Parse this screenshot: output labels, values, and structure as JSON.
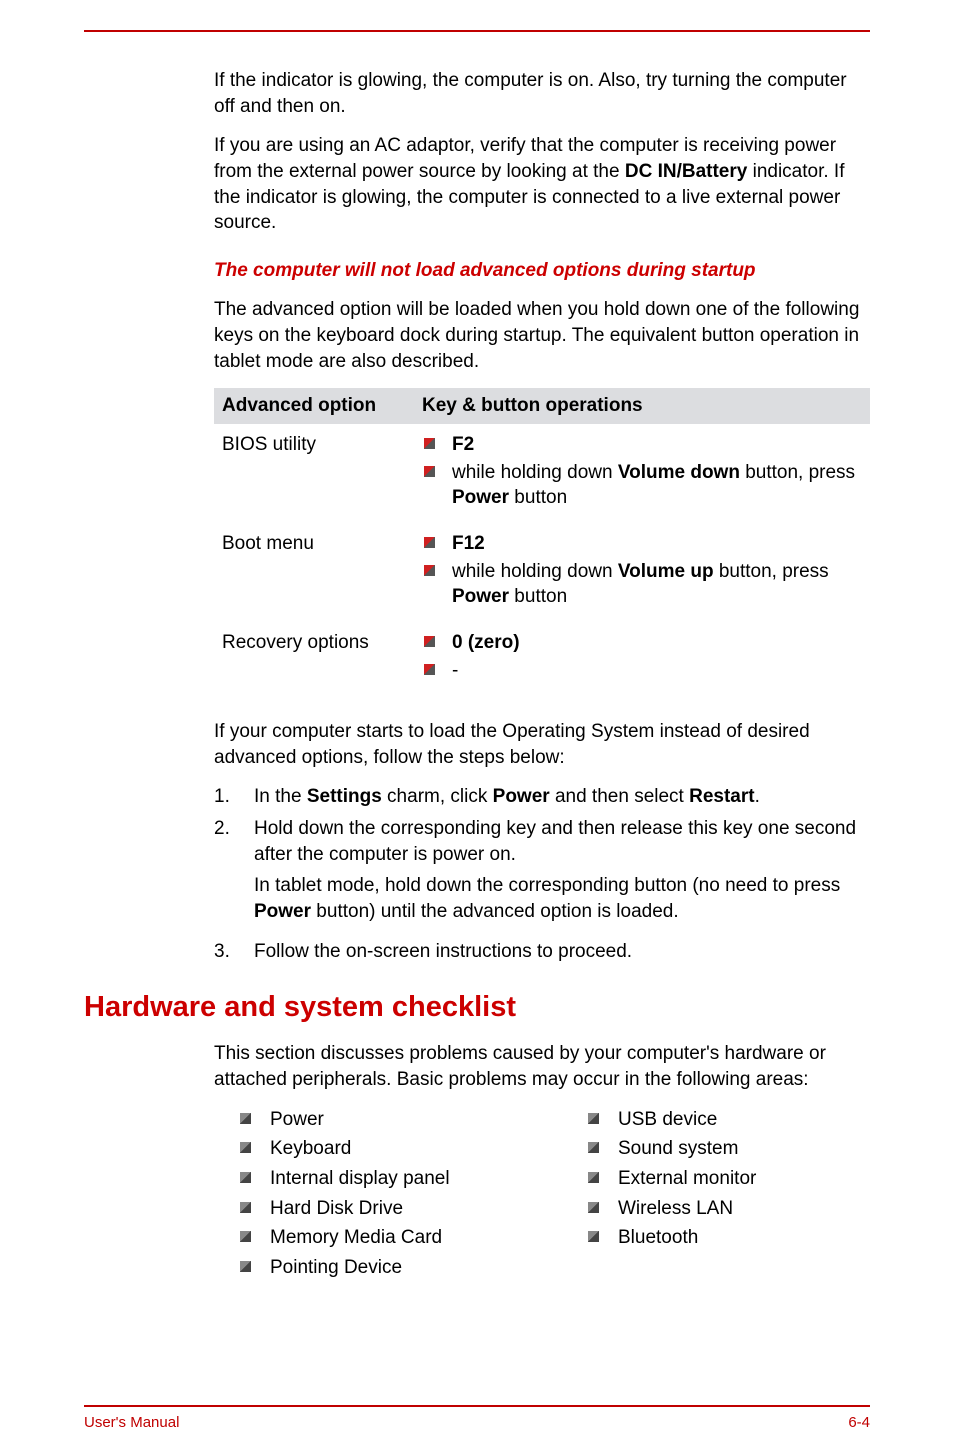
{
  "para_indicator": "If the indicator is glowing, the computer is on. Also, try turning the computer off and then on.",
  "para_ac_1": "If you are using an AC adaptor, verify that the computer is receiving power from the external power source by looking at the ",
  "para_ac_bold": "DC IN/Battery",
  "para_ac_2": " indicator. If the indicator is glowing, the computer is connected to a live external power source.",
  "heading_noload": "The computer will not load advanced options during startup",
  "para_advanced_intro": "The advanced option will be loaded when you hold down one of the following keys on the keyboard dock during startup. The equivalent button operation in tablet mode are also described.",
  "table": {
    "col1": "Advanced option",
    "col2": "Key & button operations",
    "rows": [
      {
        "label": "BIOS utility",
        "items": [
          {
            "bold1": "F2"
          },
          {
            "pre": "while holding down ",
            "bold": "Volume down",
            "mid": " button, press ",
            "bold2": "Power",
            "post": " button"
          }
        ]
      },
      {
        "label": "Boot menu",
        "items": [
          {
            "bold1": "F12"
          },
          {
            "pre": "while holding down ",
            "bold": "Volume up",
            "mid": " button, press ",
            "bold2": "Power",
            "post": " button"
          }
        ]
      },
      {
        "label": "Recovery options",
        "items": [
          {
            "bold1": "0 (zero)"
          },
          {
            "dash": "-"
          }
        ]
      }
    ]
  },
  "para_fallback": "If your computer starts to load the Operating System instead of desired advanced options, follow the steps below:",
  "steps": {
    "s1_a": "In the ",
    "s1_b": "Settings",
    "s1_c": " charm, click ",
    "s1_d": "Power",
    "s1_e": " and then select ",
    "s1_f": "Restart",
    "s1_g": ".",
    "s2": "Hold down the corresponding key and then release this key one second after the computer is power on.",
    "s2sub_a": "In tablet mode, hold down the corresponding button (no need to press ",
    "s2sub_b": "Power",
    "s2sub_c": " button) until the advanced option is loaded.",
    "s3": "Follow the on-screen instructions to proceed."
  },
  "heading_hw": "Hardware and system checklist",
  "para_hw_intro": "This section discusses problems caused by your computer's hardware or attached peripherals. Basic problems may occur in the following areas:",
  "checklist": {
    "left": [
      "Power",
      "Keyboard",
      "Internal display panel",
      "Hard Disk Drive",
      "Memory Media Card",
      "Pointing Device"
    ],
    "right": [
      "USB device",
      "Sound system",
      "External monitor",
      "Wireless LAN",
      "Bluetooth"
    ]
  },
  "footer_left": "User's Manual",
  "footer_right": "6-4"
}
